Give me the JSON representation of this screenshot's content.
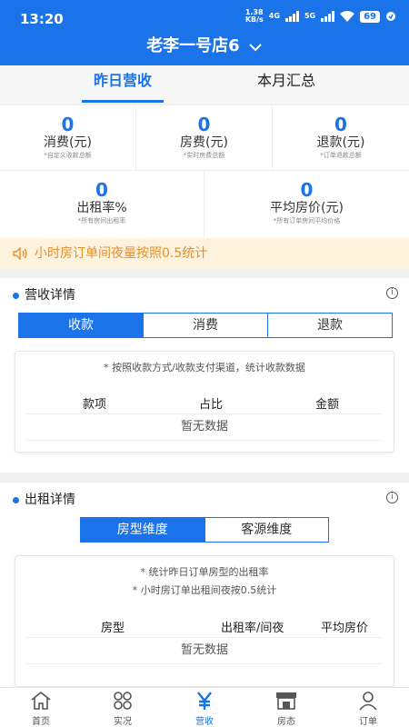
{
  "status_bar": {
    "time": "13:20",
    "net_speed_top": "1.38",
    "net_speed_bottom": "KB/s",
    "net_type": "4G",
    "net_type2": "5G",
    "battery": "69"
  },
  "header": {
    "title": "老李一号店6"
  },
  "tabs": [
    {
      "label": "昨日营收",
      "active": true
    },
    {
      "label": "本月汇总",
      "active": false
    }
  ],
  "stats_row1": [
    {
      "value": "0",
      "label": "消费(元)",
      "sub": "*自定义收款总额"
    },
    {
      "value": "0",
      "label": "房费(元)",
      "sub": "*实时房费总额"
    },
    {
      "value": "0",
      "label": "退款(元)",
      "sub": "*订单退款总额"
    }
  ],
  "stats_row2": [
    {
      "value": "0",
      "label": "出租率%",
      "sub": "*所有房间出租率"
    },
    {
      "value": "0",
      "label": "平均房价(元)",
      "sub": "*所有订单房间平均价格"
    }
  ],
  "notice": {
    "text": "小时房订单间夜量按照0.5统计"
  },
  "revenue": {
    "title": "营收详情",
    "tabs": [
      "收款",
      "消费",
      "退款"
    ],
    "note": "* 按照收款方式/收款支付渠道，统计收款数据",
    "columns": [
      "款项",
      "占比",
      "金额"
    ],
    "empty": "暂无数据"
  },
  "rental": {
    "title": "出租详情",
    "tabs": [
      "房型维度",
      "客源维度"
    ],
    "note1": "* 统计昨日订单房型的出租率",
    "note2": "* 小时房订单出租间夜按0.5统计",
    "columns": [
      "房型",
      "出租率/间夜",
      "平均房价"
    ],
    "empty": "暂无数据"
  },
  "bottom_nav": [
    {
      "label": "首页",
      "icon": "home-icon"
    },
    {
      "label": "实况",
      "icon": "grid-icon"
    },
    {
      "label": "营收",
      "icon": "yen-icon",
      "active": true
    },
    {
      "label": "房态",
      "icon": "store-icon"
    },
    {
      "label": "订单",
      "icon": "user-icon"
    }
  ],
  "colors": {
    "primary": "#1a73e8",
    "notice_bg": "#fdf2dc",
    "notice_text": "#e6902a"
  }
}
